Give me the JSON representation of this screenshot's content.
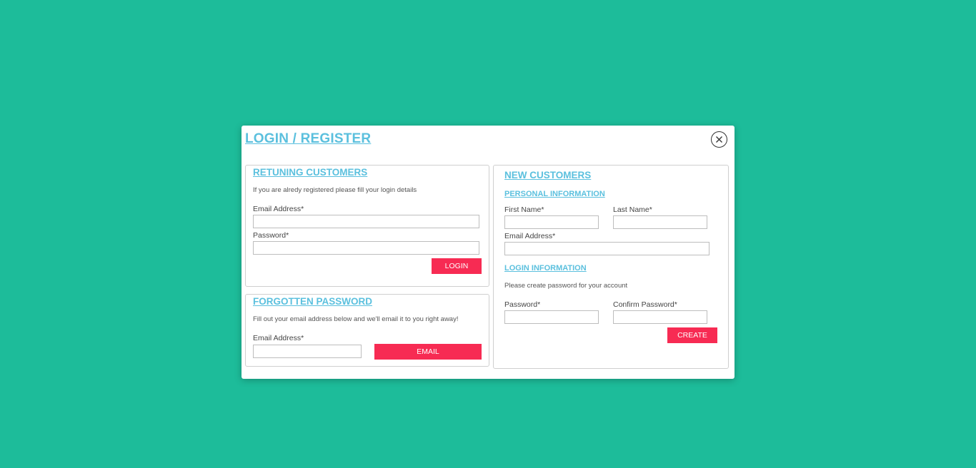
{
  "modal": {
    "title": "LOGIN / REGISTER",
    "close_icon": "close-icon"
  },
  "returning": {
    "title": "RETUNING CUSTOMERS",
    "help": "If you are alredy registered please fill your login details",
    "email_label": "Email Address*",
    "email_value": "",
    "password_label": "Password*",
    "password_value": "",
    "login_button": "LOGIN"
  },
  "forgot": {
    "title": "FORGOTTEN PASSWORD",
    "help": "Fill out your email address below and we'll email it to you right away!",
    "email_label": "Email Address*",
    "email_value": "",
    "email_button": "EMAIL"
  },
  "new_customers": {
    "title": "NEW CUSTOMERS",
    "personal_title": "PERSONAL INFORMATION",
    "first_name_label": "First Name*",
    "last_name_label": "Last Name*",
    "email_label": "Email Address*",
    "login_title": "LOGIN INFORMATION",
    "login_help": "Please create password for your account",
    "password_label": "Password*",
    "confirm_password_label": "Confirm Password*",
    "create_button": "CREATE"
  },
  "colors": {
    "background": "#1dbc9a",
    "accent_link": "#5bc0de",
    "button": "#f72b53"
  }
}
